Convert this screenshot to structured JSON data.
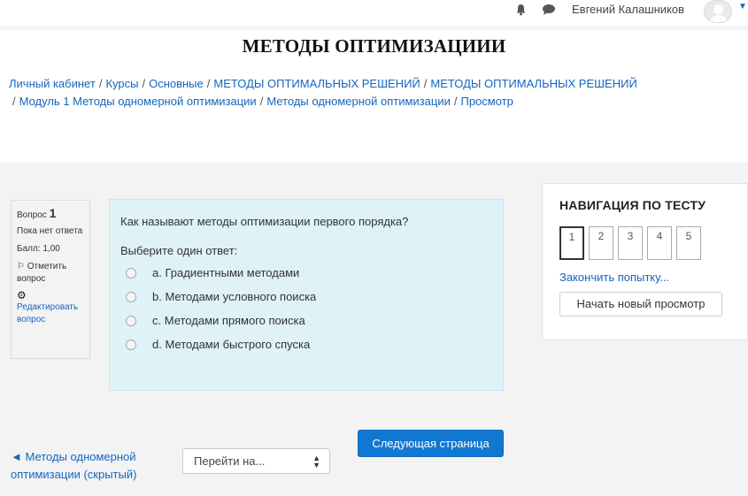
{
  "topbar": {
    "user_name": "Евгений Калашников",
    "icons": [
      "bell-icon",
      "chat-icon",
      "avatar",
      "caret-down-icon"
    ]
  },
  "page": {
    "title": "МЕТОДЫ ОПТИМИЗАЦИИИ"
  },
  "breadcrumb": [
    "Личный кабинет",
    "Курсы",
    "Основные",
    "МЕТОДЫ ОПТИМАЛЬНЫХ РЕШЕНИЙ",
    "МЕТОДЫ ОПТИМАЛЬНЫХ РЕШЕНИЙ",
    "Модуль 1 Методы одномерной оптимизации",
    "Методы одномерной оптимизации",
    "Просмотр"
  ],
  "question_info": {
    "label": "Вопрос",
    "number": "1",
    "state": "Пока нет ответа",
    "grade": "Балл: 1,00",
    "flag": "Отметить вопрос",
    "edit": "Редактировать вопрос"
  },
  "question": {
    "prompt": "Как называют методы оптимизации первого порядка?",
    "choose": "Выберите один ответ:",
    "options": [
      "a. Градиентными методами",
      "b. Методами условного поиска",
      "c. Методами прямого поиска",
      "d. Методами быстрого спуска"
    ]
  },
  "bottom_nav": {
    "prev": "◄ Методы одномерной оптимизации (скрытый)",
    "jump_placeholder": "Перейти на...",
    "next": "Следующая страница"
  },
  "quiz_nav": {
    "title": "НАВИГАЦИЯ ПО ТЕСТУ",
    "questions": [
      "1",
      "2",
      "3",
      "4",
      "5"
    ],
    "current": "1",
    "finish": "Закончить попытку...",
    "new_preview": "Начать новый просмотр"
  }
}
